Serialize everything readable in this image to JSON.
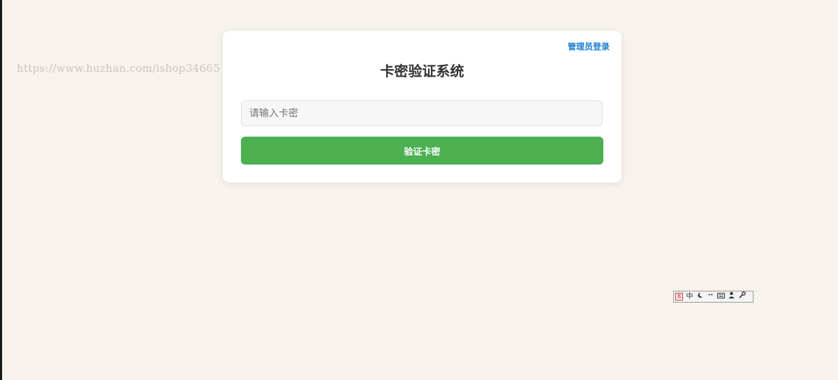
{
  "watermark": {
    "text": "https://www.huzhan.com/ishop34665"
  },
  "card": {
    "admin_link": "管理员登录",
    "title": "卡密验证系统",
    "input_placeholder": "请输入卡密",
    "input_value": "",
    "verify_button": "验证卡密"
  },
  "ime_toolbar": {
    "mode_label": "中",
    "icons": [
      "ime-logo-icon",
      "half-moon-icon",
      "punctuation-icon",
      "keyboard-icon",
      "user-icon",
      "wrench-icon"
    ]
  },
  "colors": {
    "background": "#f7f2eb",
    "card": "#ffffff",
    "accent_link": "#1a7fd4",
    "button": "#4caf50",
    "title": "#333333"
  }
}
